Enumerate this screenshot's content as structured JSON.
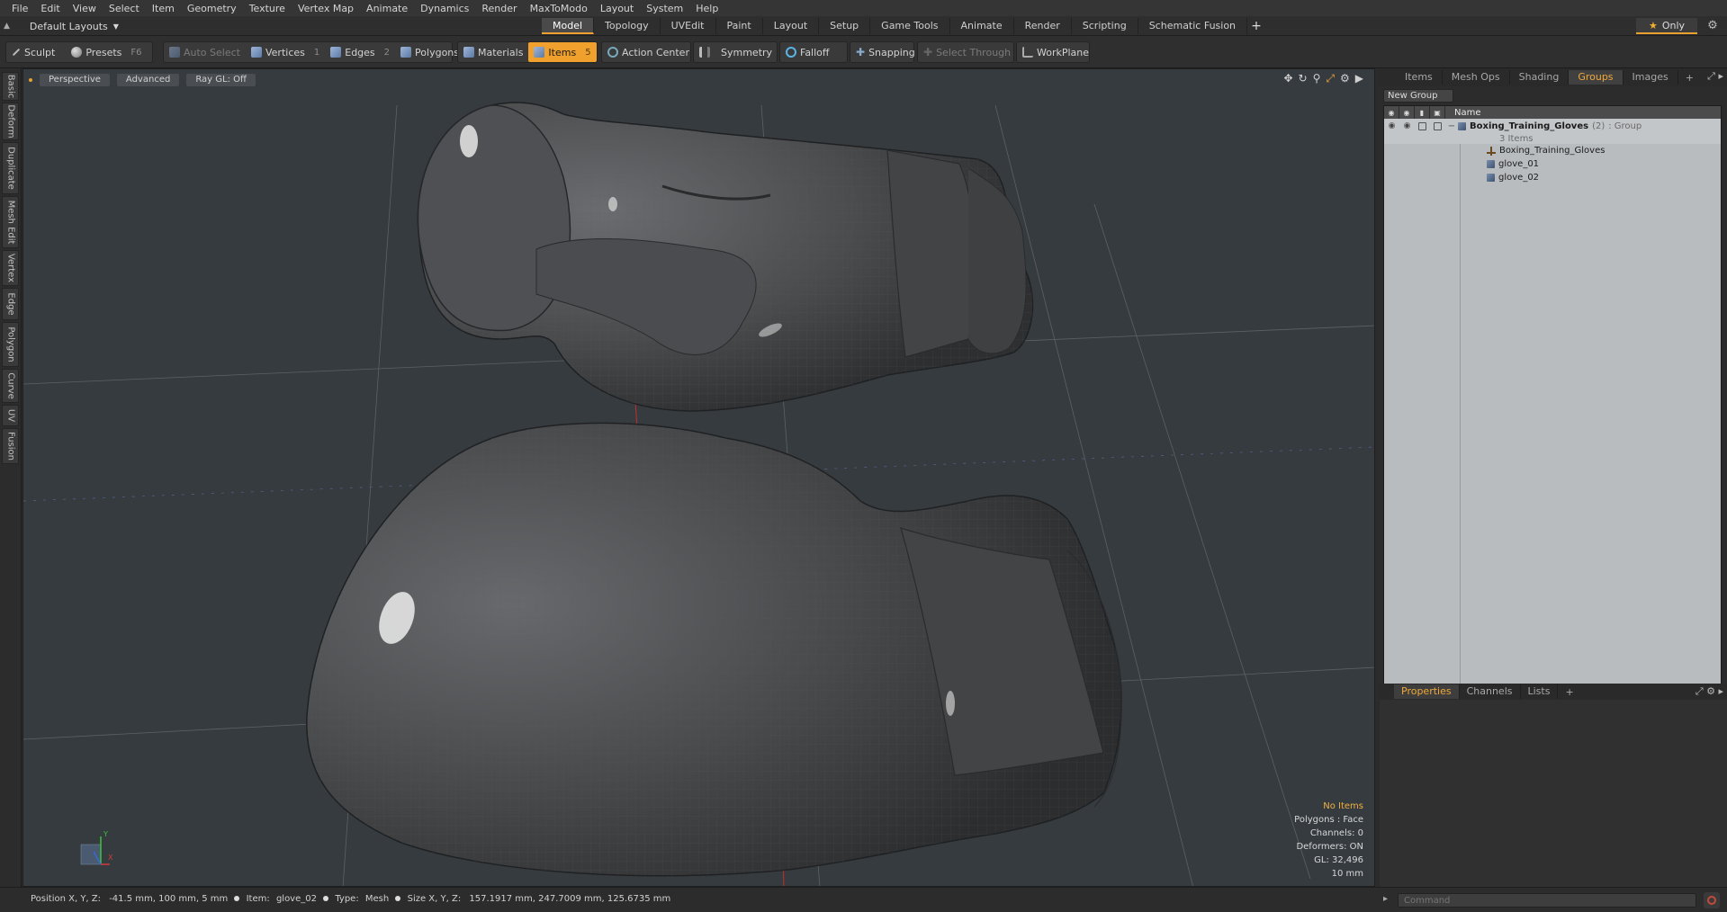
{
  "menu": [
    "File",
    "Edit",
    "View",
    "Select",
    "Item",
    "Geometry",
    "Texture",
    "Vertex Map",
    "Animate",
    "Dynamics",
    "Render",
    "MaxToModo",
    "Layout",
    "System",
    "Help"
  ],
  "layout_dropdown": "Default Layouts",
  "layout_tabs": [
    {
      "label": "Model",
      "active": true
    },
    {
      "label": "Topology"
    },
    {
      "label": "UVEdit"
    },
    {
      "label": "Paint"
    },
    {
      "label": "Layout"
    },
    {
      "label": "Setup"
    },
    {
      "label": "Game Tools"
    },
    {
      "label": "Animate"
    },
    {
      "label": "Render"
    },
    {
      "label": "Scripting"
    },
    {
      "label": "Schematic Fusion"
    }
  ],
  "only_label": "Only",
  "toolbar": {
    "sculpt": "Sculpt",
    "presets": "Presets",
    "presets_key": "F6",
    "auto_select": "Auto Select",
    "vertices": "Vertices",
    "vertices_key": "1",
    "edges": "Edges",
    "edges_key": "2",
    "polygons": "Polygons",
    "materials": "Materials",
    "items": "Items",
    "items_key": "5",
    "action_center": "Action Center",
    "symmetry": "Symmetry",
    "falloff": "Falloff",
    "snapping": "Snapping",
    "select_through": "Select Through",
    "workplane": "WorkPlane"
  },
  "left_tabs": [
    "Basic",
    "Deform",
    "Duplicate",
    "Mesh Edit",
    "Vertex",
    "Edge",
    "Polygon",
    "Curve",
    "UV",
    "Fusion"
  ],
  "viewport": {
    "view": "Perspective",
    "shading": "Advanced",
    "raygl": "Ray GL: Off",
    "stats": {
      "items": "No Items",
      "polygons": "Polygons : Face",
      "channels": "Channels: 0",
      "deformers": "Deformers: ON",
      "gl": "GL: 32,496",
      "scale": "10 mm"
    },
    "axis_y": "Y",
    "axis_x": "X"
  },
  "right_panel": {
    "tabs": [
      {
        "label": "Items"
      },
      {
        "label": "Mesh Ops"
      },
      {
        "label": "Shading"
      },
      {
        "label": "Groups",
        "active": true
      },
      {
        "label": "Images"
      }
    ],
    "new_group": "New Group",
    "column_name": "Name",
    "group": {
      "name": "Boxing_Training_Gloves",
      "count": "(2)",
      "type": ": Group",
      "items_count": "3 Items",
      "children": [
        "Boxing_Training_Gloves",
        "glove_01",
        "glove_02"
      ]
    },
    "bottom_tabs": [
      {
        "label": "Properties",
        "active": true
      },
      {
        "label": "Channels"
      },
      {
        "label": "Lists"
      }
    ]
  },
  "status": {
    "position_label": "Position X, Y, Z:",
    "position": "-41.5 mm, 100 mm, 5 mm",
    "item_label": "Item:",
    "item": "glove_02",
    "type_label": "Type:",
    "type": "Mesh",
    "size_label": "Size X, Y, Z:",
    "size": "157.1917 mm, 247.7009 mm, 125.6735 mm"
  },
  "command_placeholder": "Command",
  "colors": {
    "accent": "#f0a02c",
    "viewport_bg": "#363b3f",
    "mesh": "#4a4b4d"
  }
}
